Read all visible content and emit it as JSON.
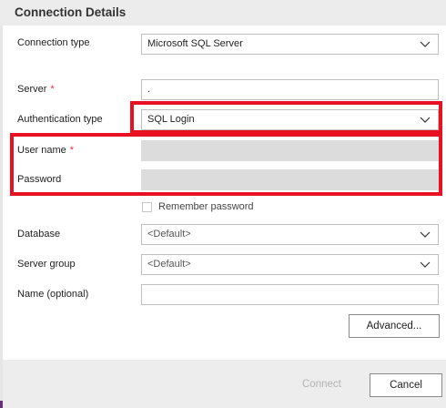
{
  "header": {
    "title": "Connection Details"
  },
  "form": {
    "connection_type": {
      "label": "Connection type",
      "value": "Microsoft SQL Server"
    },
    "server": {
      "label": "Server",
      "required_mark": "*",
      "value": "."
    },
    "auth_type": {
      "label": "Authentication type",
      "value": "SQL Login"
    },
    "user_name": {
      "label": "User name",
      "required_mark": "*",
      "value": ""
    },
    "password": {
      "label": "Password",
      "value": ""
    },
    "remember_password": {
      "label": "Remember password",
      "checked": false
    },
    "database": {
      "label": "Database",
      "value": "<Default>"
    },
    "server_group": {
      "label": "Server group",
      "value": "<Default>"
    },
    "name_optional": {
      "label": "Name (optional)",
      "value": ""
    }
  },
  "buttons": {
    "advanced": "Advanced...",
    "connect": "Connect",
    "cancel": "Cancel"
  },
  "colors": {
    "highlight": "#e81123",
    "required": "#d13438",
    "disabled_field": "#dcdcdc",
    "footer": "#ededed"
  },
  "icons": {
    "dropdown": "chevron-down-icon"
  }
}
